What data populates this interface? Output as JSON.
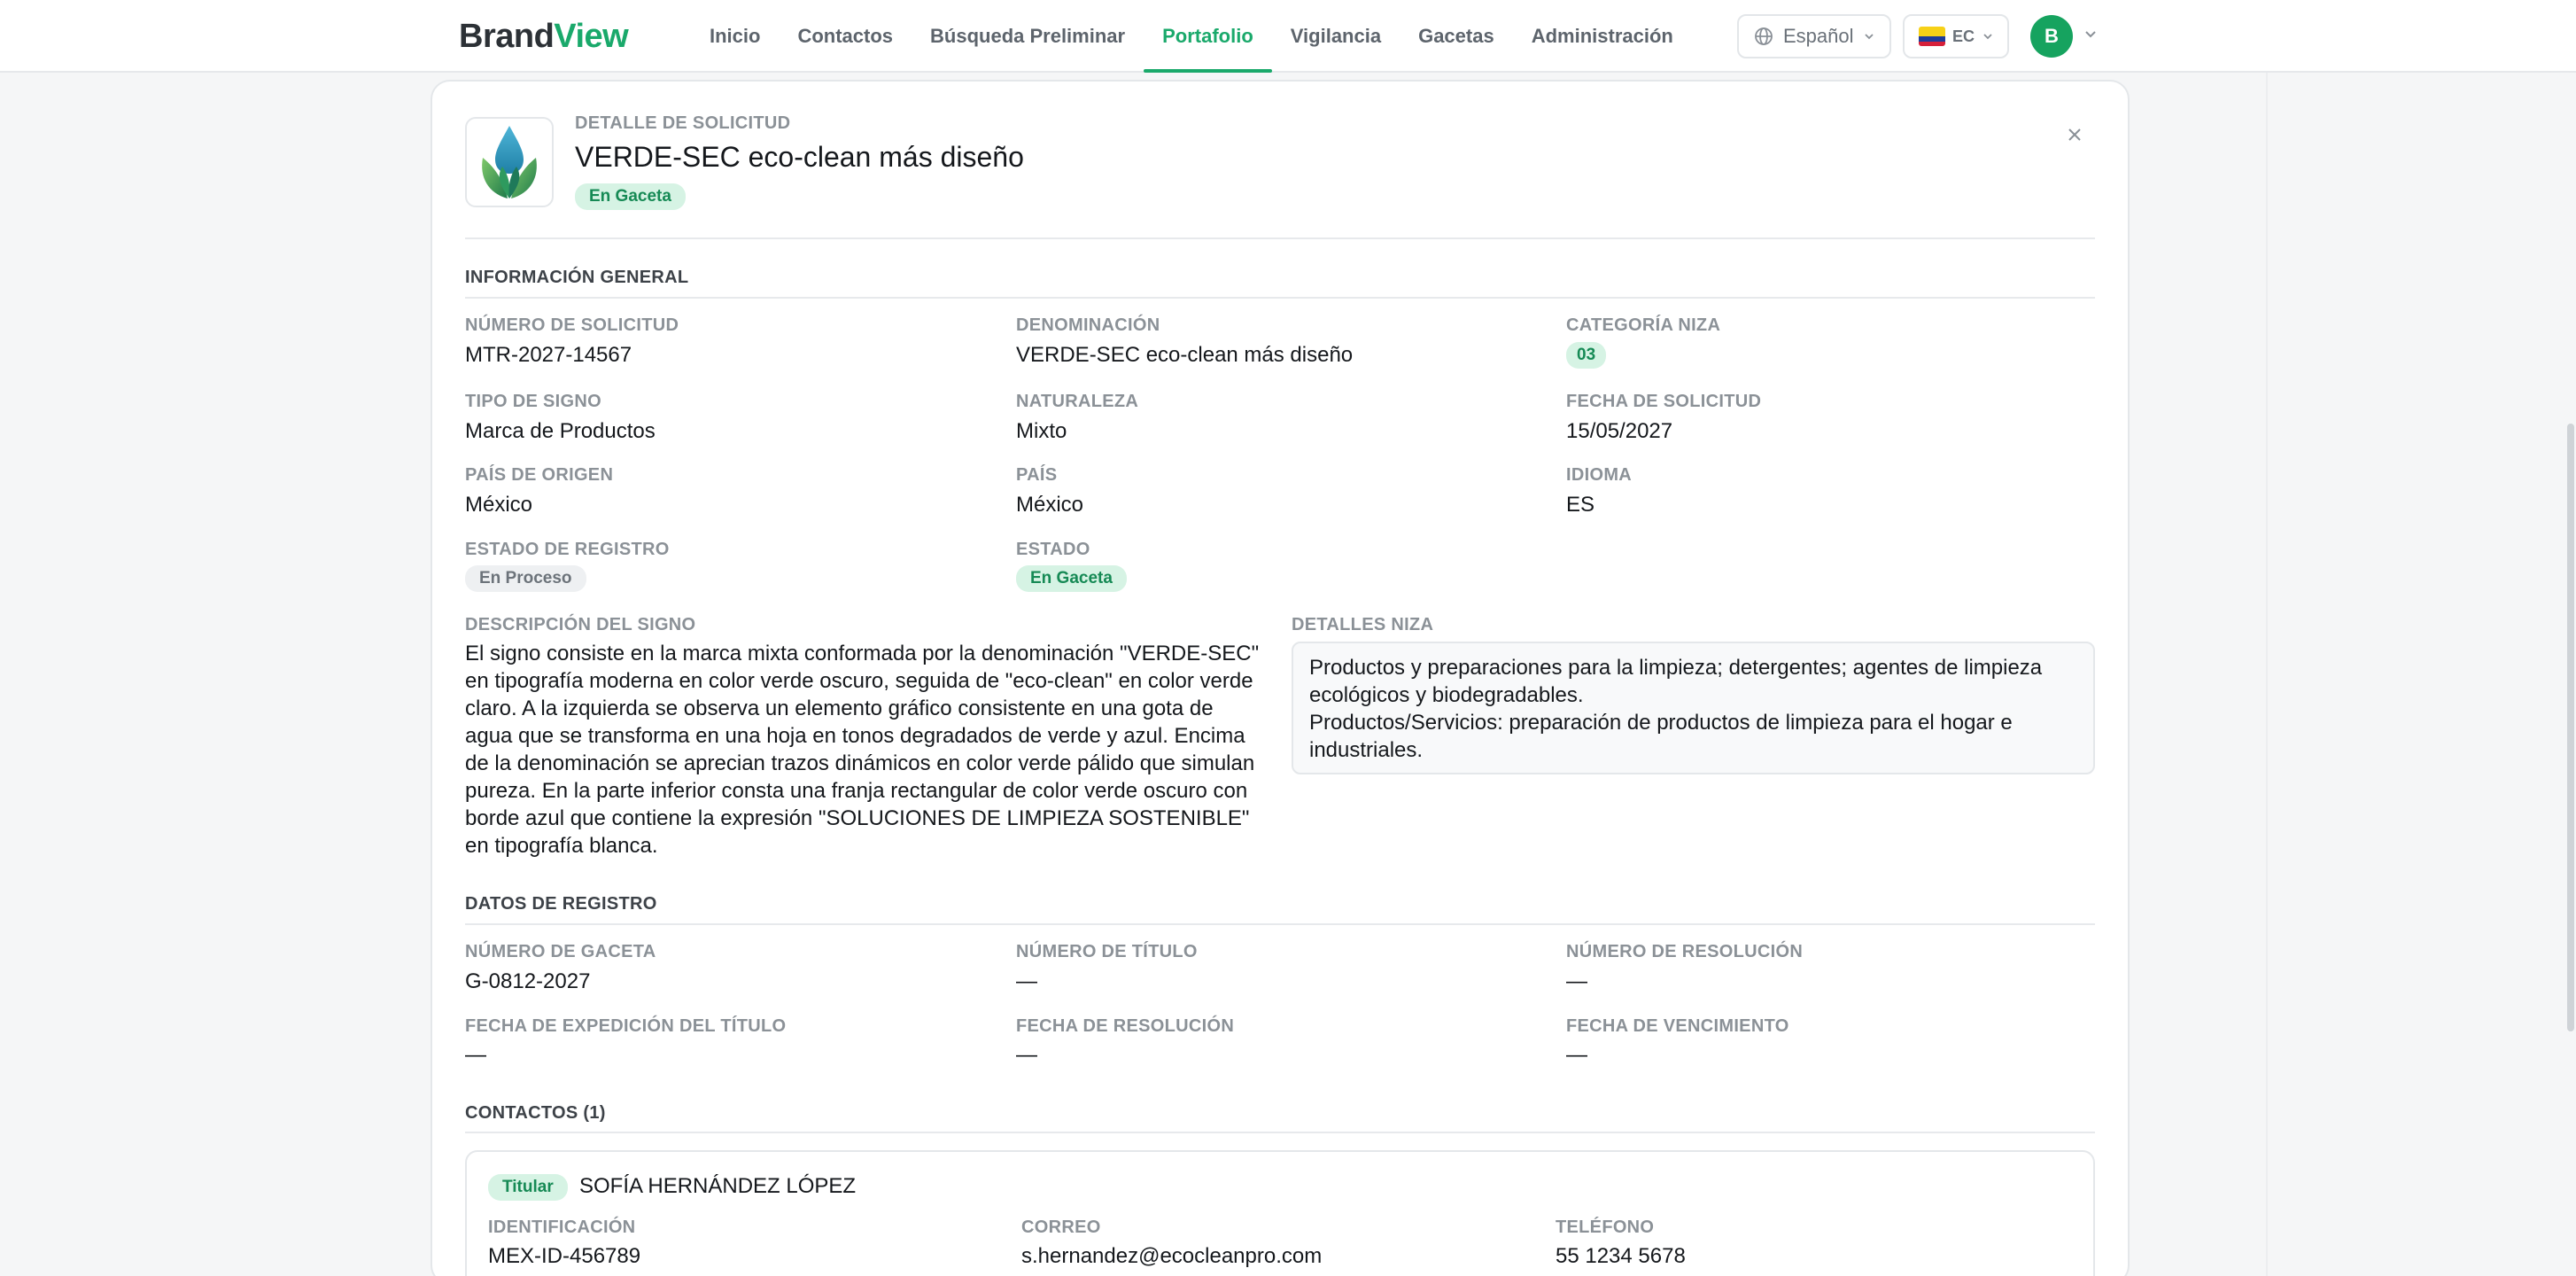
{
  "header": {
    "logo_brand": "Brand",
    "logo_view": "View",
    "nav": [
      {
        "label": "Inicio"
      },
      {
        "label": "Contactos"
      },
      {
        "label": "Búsqueda Preliminar"
      },
      {
        "label": "Portafolio"
      },
      {
        "label": "Vigilancia"
      },
      {
        "label": "Gacetas"
      },
      {
        "label": "Administración"
      }
    ],
    "active_nav": "Portafolio",
    "language": "Español",
    "country": "EC",
    "avatar_initial": "B"
  },
  "detail": {
    "eyebrow": "DETALLE DE SOLICITUD",
    "title": "VERDE-SEC eco-clean más diseño",
    "status_badge": "En Gaceta"
  },
  "general": {
    "section_title": "INFORMACIÓN GENERAL",
    "numero_solicitud_label": "NÚMERO DE SOLICITUD",
    "numero_solicitud": "MTR-2027-14567",
    "denominacion_label": "DENOMINACIÓN",
    "denominacion": "VERDE-SEC eco-clean más diseño",
    "categoria_niza_label": "CATEGORÍA NIZA",
    "categoria_niza": "03",
    "tipo_signo_label": "TIPO DE SIGNO",
    "tipo_signo": "Marca de Productos",
    "naturaleza_label": "NATURALEZA",
    "naturaleza": "Mixto",
    "fecha_solicitud_label": "FECHA DE SOLICITUD",
    "fecha_solicitud": "15/05/2027",
    "pais_origen_label": "PAÍS DE ORIGEN",
    "pais_origen": "México",
    "pais_label": "PAÍS",
    "pais": "México",
    "idioma_label": "IDIOMA",
    "idioma": "ES",
    "estado_registro_label": "ESTADO DE REGISTRO",
    "estado_registro": "En Proceso",
    "estado_label": "ESTADO",
    "estado": "En Gaceta",
    "descripcion_label": "DESCRIPCIÓN DEL SIGNO",
    "descripcion": "El signo consiste en la marca mixta conformada por la denominación \"VERDE-SEC\" en tipografía moderna en color verde oscuro, seguida de \"eco-clean\" en color verde claro. A la izquierda se observa un elemento gráfico consistente en una gota de agua que se transforma en una hoja en tonos degradados de verde y azul. Encima de la denominación se aprecian trazos dinámicos en color verde pálido que simulan pureza. En la parte inferior consta una franja rectangular de color verde oscuro con borde azul que contiene la expresión \"SOLUCIONES DE LIMPIEZA SOSTENIBLE\" en tipografía blanca.",
    "niza_label": "DETALLES NIZA",
    "niza_line1": "Productos y preparaciones para la limpieza; detergentes; agentes de limpieza ecológicos y biodegradables.",
    "niza_line2": "Productos/Servicios: preparación de productos de limpieza para el hogar e industriales."
  },
  "registro": {
    "section_title": "DATOS DE REGISTRO",
    "numero_gaceta_label": "NÚMERO DE GACETA",
    "numero_gaceta": "G-0812-2027",
    "numero_titulo_label": "NÚMERO DE TÍTULO",
    "numero_titulo": "—",
    "numero_resolucion_label": "NÚMERO DE RESOLUCIÓN",
    "numero_resolucion": "—",
    "fecha_expedicion_label": "FECHA DE EXPEDICIÓN DEL TÍTULO",
    "fecha_expedicion": "—",
    "fecha_resolucion_label": "FECHA DE RESOLUCIÓN",
    "fecha_resolucion": "—",
    "fecha_vencimiento_label": "FECHA DE VENCIMIENTO",
    "fecha_vencimiento": "—"
  },
  "contactos": {
    "section_title": "CONTACTOS (1)",
    "items": [
      {
        "role": "Titular",
        "name": "SOFÍA HERNÁNDEZ LÓPEZ",
        "identificacion_label": "IDENTIFICACIÓN",
        "identificacion": "MEX-ID-456789",
        "correo_label": "CORREO",
        "correo": "s.hernandez@ecocleanpro.com",
        "telefono_label": "TELÉFONO",
        "telefono": "55 1234 5678"
      }
    ]
  },
  "colors": {
    "accent": "#1aa96b",
    "badge_green_bg": "#d6f3e4",
    "badge_green_text": "#168a55",
    "badge_grey_bg": "#eef0f2"
  },
  "icons": {
    "language": "globe-icon",
    "close": "close-icon",
    "dropdown": "chevron-down-icon",
    "flag": "ecuador-flag-icon",
    "brand_image": "water-drop-leaf-logo"
  }
}
